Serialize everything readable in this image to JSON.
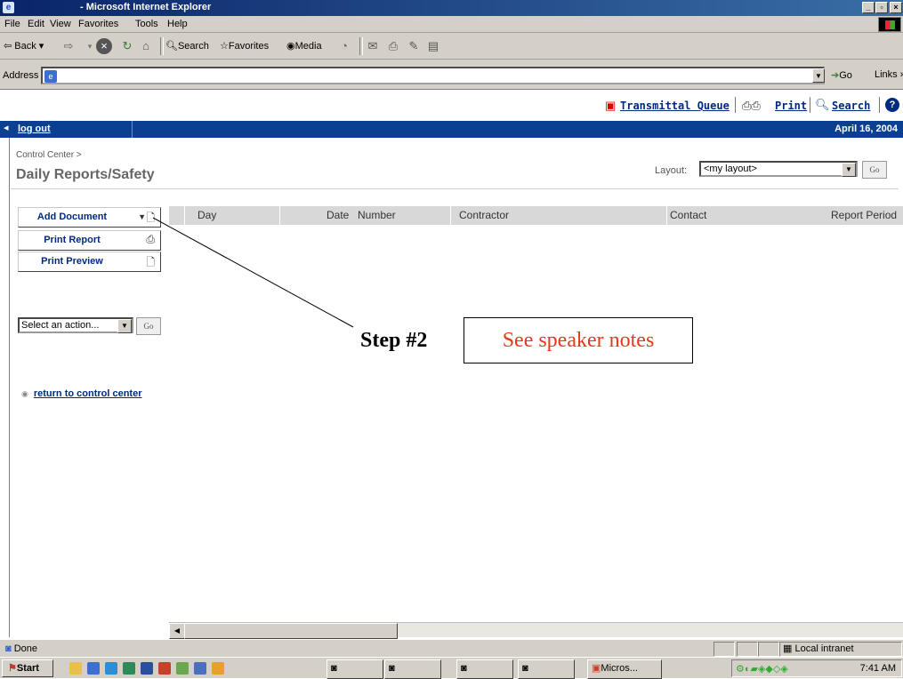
{
  "window": {
    "title": "- Microsoft Internet Explorer"
  },
  "menu": [
    "File",
    "Edit",
    "View",
    "Favorites",
    "Tools",
    "Help"
  ],
  "toolbar": {
    "back": "Back",
    "search": "Search",
    "favorites": "Favorites",
    "media": "Media"
  },
  "address": {
    "label": "Address",
    "go": "Go",
    "links": "Links"
  },
  "header": {
    "transmittal": "Transmittal Queue",
    "print": "Print",
    "search": "Search"
  },
  "nav": {
    "logout": "log out",
    "date": "April 16, 2004"
  },
  "page": {
    "breadcrumb": "Control Center >",
    "title": "Daily Reports/Safety",
    "layout_label": "Layout:",
    "layout_value": "<my layout>",
    "go": "Go"
  },
  "actions": {
    "add_document": "Add Document",
    "print_report": "Print Report",
    "print_preview": "Print Preview",
    "select_action": "Select an action...",
    "go": "Go",
    "return_link": "return to control center"
  },
  "table": {
    "columns": [
      "Day",
      "Date",
      "Number",
      "Contractor",
      "Contact",
      "Report Period"
    ]
  },
  "callout": {
    "step": "Step #2",
    "note": "See speaker notes",
    "note_color": "#e8361a"
  },
  "status": {
    "text": "Done",
    "zone": "Local intranet"
  },
  "taskbar": {
    "start": "Start",
    "task_micros": "Micros...",
    "clock": "7:41 AM"
  }
}
